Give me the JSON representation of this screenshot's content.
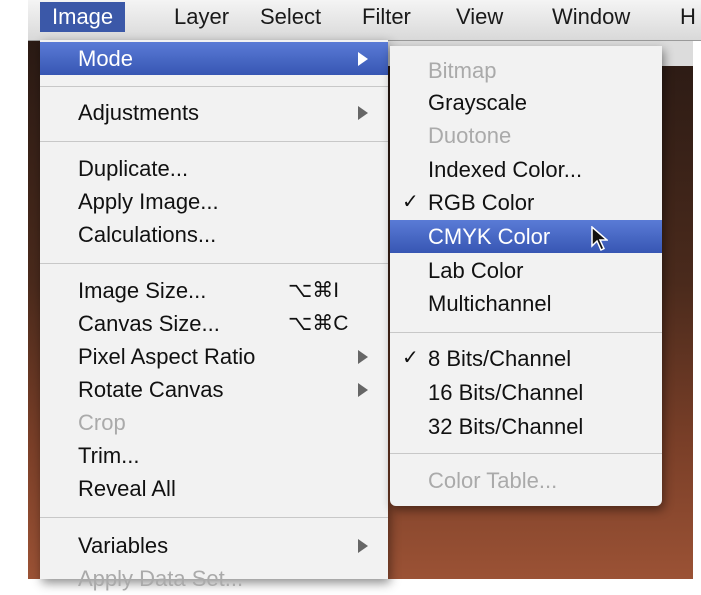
{
  "menubar": {
    "items": [
      "Image",
      "Layer",
      "Select",
      "Filter",
      "View",
      "Window",
      "H"
    ]
  },
  "image_menu": {
    "items": [
      {
        "label": "Mode",
        "submenu": true,
        "highlighted": true
      },
      {
        "label": "Adjustments",
        "submenu": true
      },
      {
        "label": "Duplicate..."
      },
      {
        "label": "Apply Image..."
      },
      {
        "label": "Calculations..."
      },
      {
        "label": "Image Size...",
        "shortcut": "⌥⌘I"
      },
      {
        "label": "Canvas Size...",
        "shortcut": "⌥⌘C"
      },
      {
        "label": "Pixel Aspect Ratio",
        "submenu": true
      },
      {
        "label": "Rotate Canvas",
        "submenu": true
      },
      {
        "label": "Crop",
        "disabled": true
      },
      {
        "label": "Trim..."
      },
      {
        "label": "Reveal All"
      },
      {
        "label": "Variables",
        "submenu": true
      },
      {
        "label": "Apply Data Set...",
        "disabled": true
      }
    ]
  },
  "mode_submenu": {
    "items": [
      {
        "label": "Bitmap",
        "disabled": true
      },
      {
        "label": "Grayscale"
      },
      {
        "label": "Duotone",
        "disabled": true
      },
      {
        "label": "Indexed Color..."
      },
      {
        "label": "RGB Color",
        "checked": true
      },
      {
        "label": "CMYK Color",
        "highlighted": true
      },
      {
        "label": "Lab Color"
      },
      {
        "label": "Multichannel"
      },
      {
        "label": "8 Bits/Channel",
        "checked": true
      },
      {
        "label": "16 Bits/Channel"
      },
      {
        "label": "32 Bits/Channel"
      },
      {
        "label": "Color Table...",
        "disabled": true
      }
    ],
    "check_glyph": "✓"
  },
  "colors": {
    "highlight": "#3b58a8",
    "menu_bg": "#f2f2f2",
    "disabled_text": "#aaaaaa"
  }
}
